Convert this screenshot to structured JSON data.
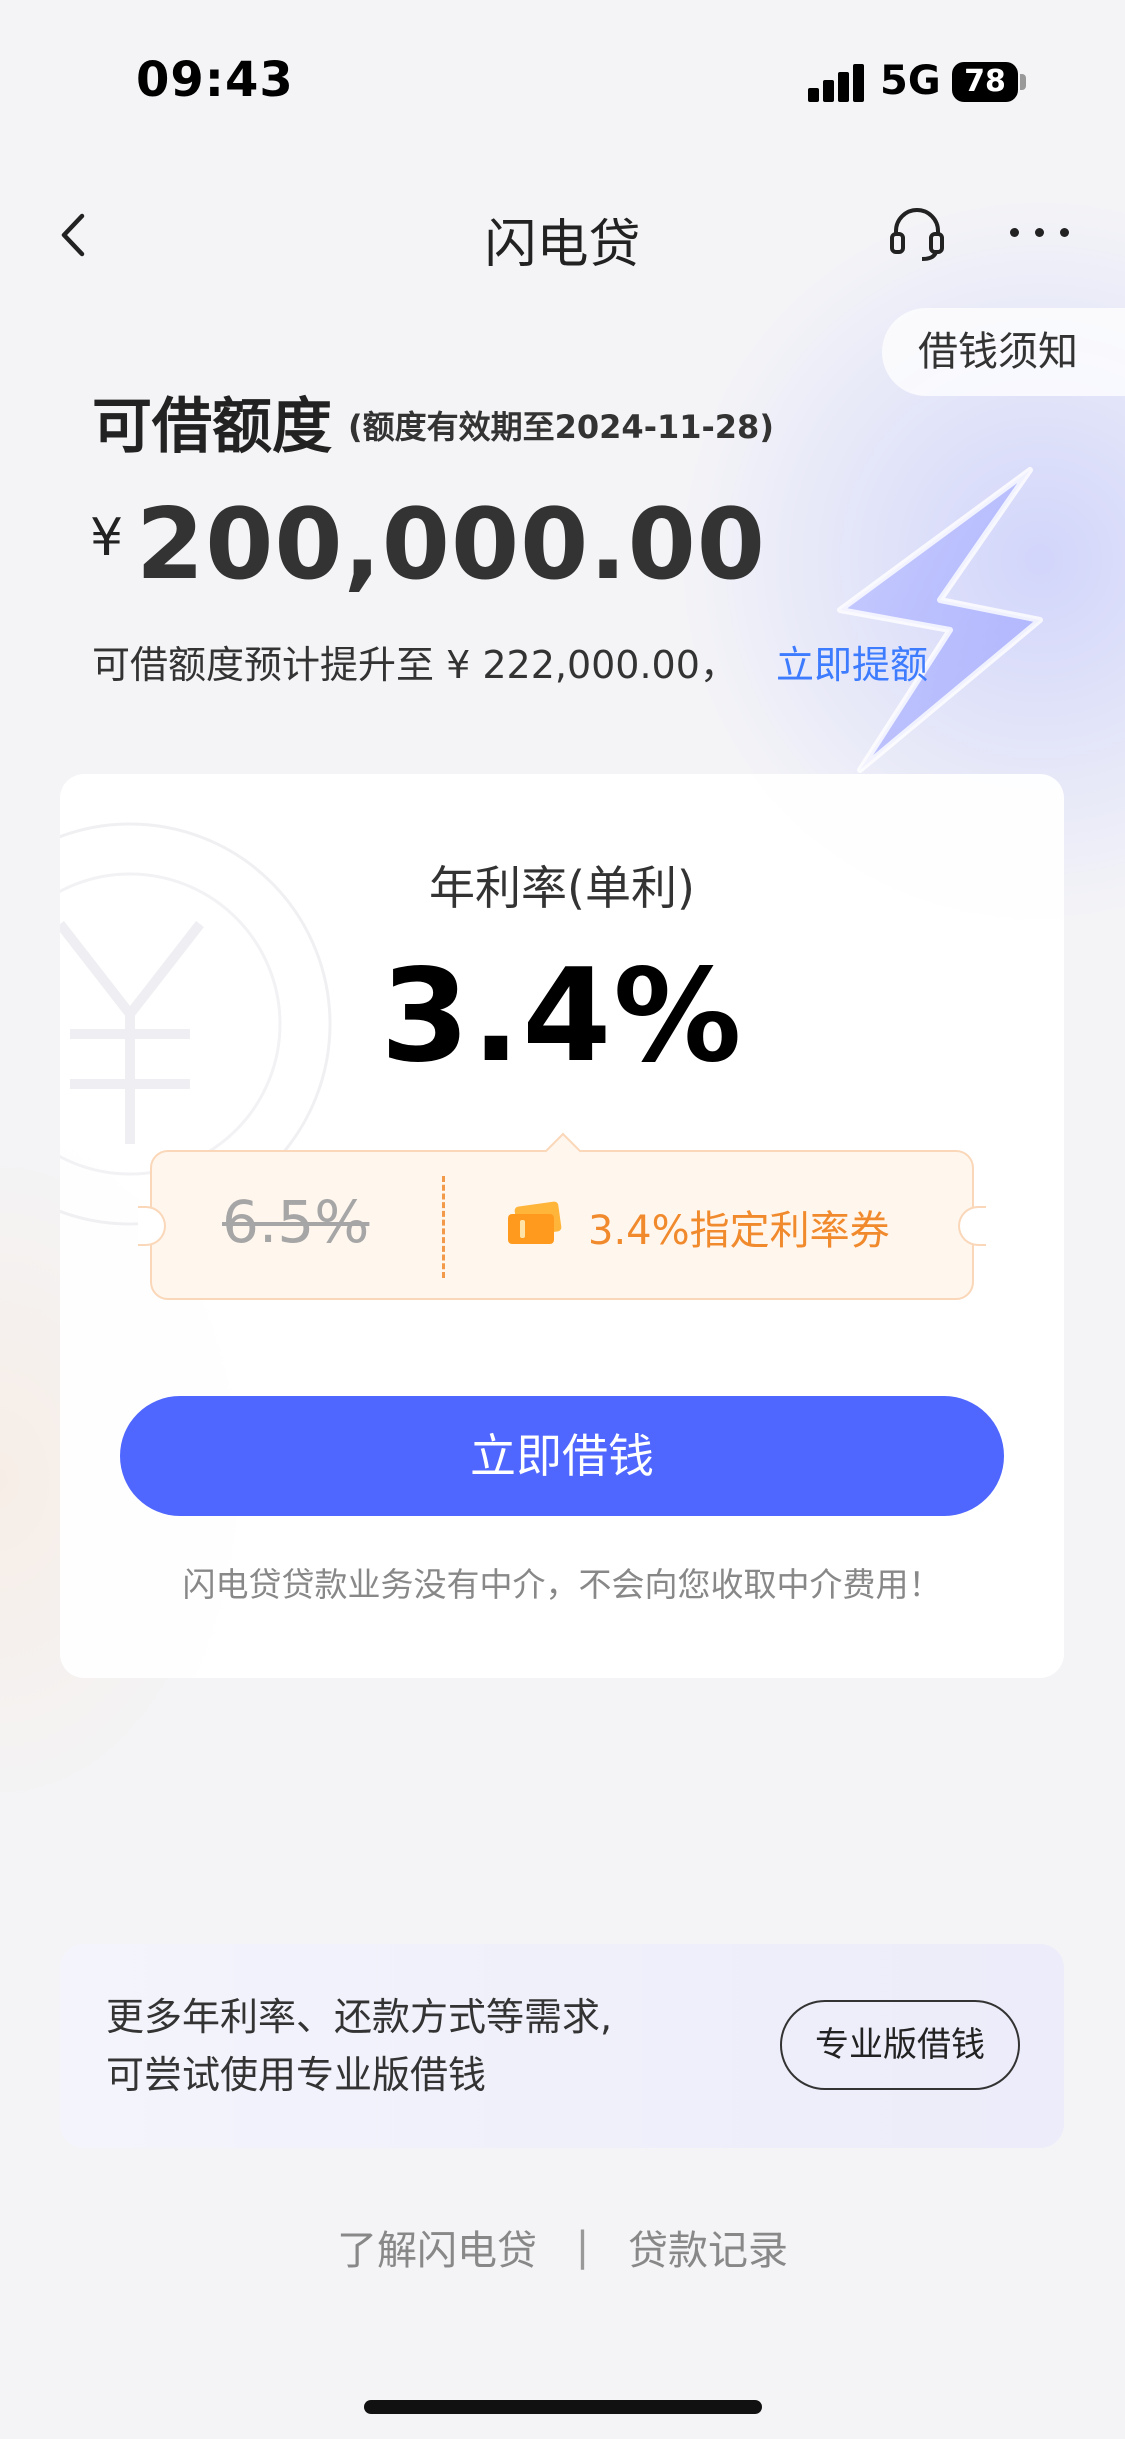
{
  "status_bar": {
    "time": "09:43",
    "network": "5G",
    "battery": "78"
  },
  "nav": {
    "title": "闪电贷"
  },
  "notice": {
    "label": "借钱须知"
  },
  "credit": {
    "label": "可借额度",
    "validity": "(额度有效期至2024-11-28)",
    "currency": "¥",
    "amount": "200,000.00",
    "raise_text": "可借额度预计提升至 ¥ 222,000.00，",
    "raise_link": "立即提额"
  },
  "rate": {
    "label": "年利率(单利)",
    "value": "3.4%",
    "old_value": "6.5%",
    "coupon_text": "3.4%指定利率券"
  },
  "actions": {
    "borrow_label": "立即借钱",
    "disclaimer": "闪电贷贷款业务没有中介，不会向您收取中介费用！"
  },
  "pro": {
    "line1": "更多年利率、还款方式等需求,",
    "line2": "可尝试使用专业版借钱",
    "button_label": "专业版借钱"
  },
  "footer": {
    "link1": "了解闪电贷",
    "separator": "|",
    "link2": "贷款记录"
  },
  "colors": {
    "primary": "#4f67ff",
    "link": "#3d7bff",
    "coupon_accent": "#f08a2c"
  },
  "icons": {
    "back": "chevron-left-icon",
    "support": "headset-icon",
    "more": "more-dots-icon",
    "coupon": "ticket-icon",
    "decor": "lightning-icon"
  }
}
